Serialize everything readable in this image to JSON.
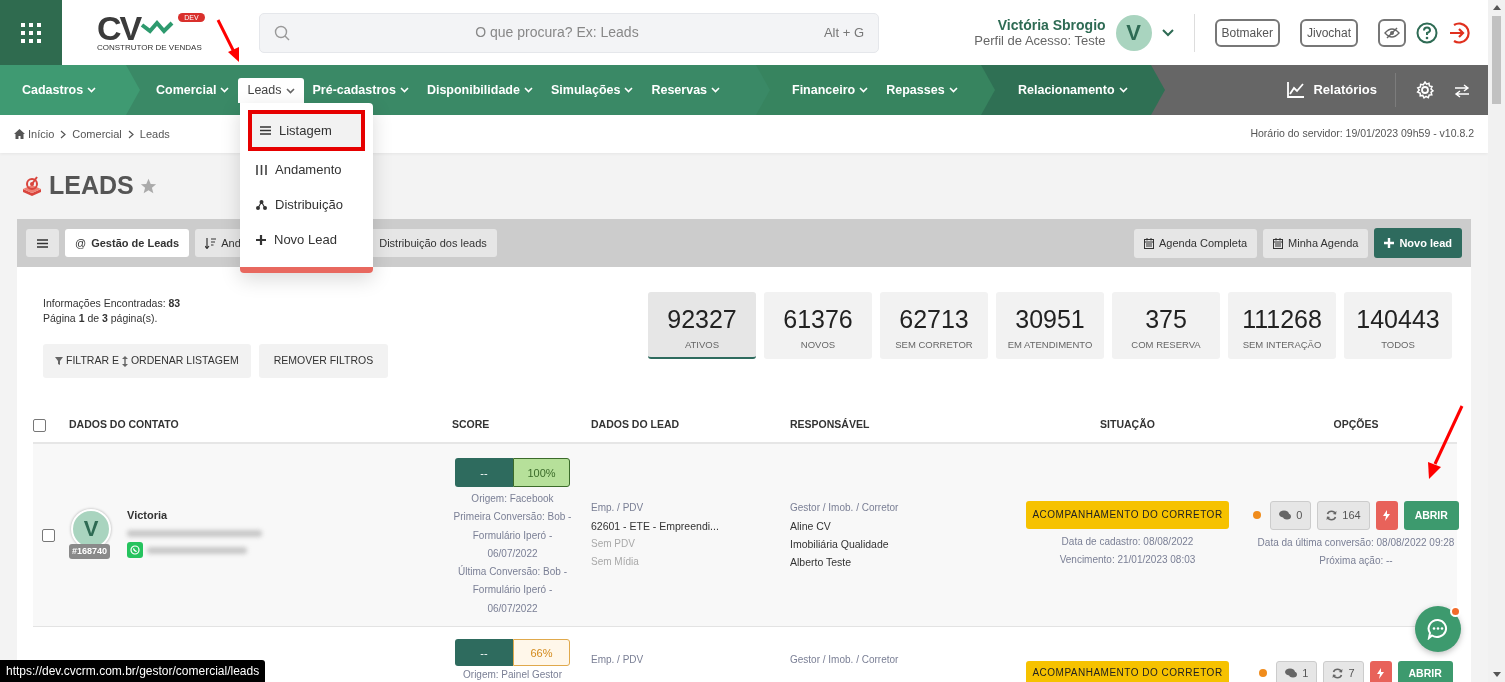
{
  "header": {
    "logo": {
      "text": "CV",
      "badge": "DEV",
      "tagline": "CONSTRUTOR DE VENDAS"
    },
    "search": {
      "placeholder": "O que procura? Ex: Leads",
      "shortcut": "Alt + G"
    },
    "user": {
      "name": "Victória Sbrogio",
      "profile": "Perfil de Acesso: Teste",
      "initial": "V"
    },
    "buttons": [
      "Botmaker",
      "Jivochat"
    ]
  },
  "nav": {
    "groups": [
      {
        "color": "#3f9a72",
        "items": [
          {
            "label": "Cadastros",
            "selected": false
          }
        ]
      },
      {
        "color": "#3a8966",
        "items": [
          {
            "label": "Comercial",
            "selected": false
          },
          {
            "label": "Leads",
            "selected": true
          },
          {
            "label": "Pré-cadastros",
            "selected": false
          },
          {
            "label": "Disponibilidade",
            "selected": false
          },
          {
            "label": "Simulações",
            "selected": false
          },
          {
            "label": "Reservas",
            "selected": false
          }
        ]
      },
      {
        "color": "#37845f",
        "items": [
          {
            "label": "Financeiro",
            "selected": false
          },
          {
            "label": "Repasses",
            "selected": false
          }
        ]
      },
      {
        "color": "#2f7054",
        "items": [
          {
            "label": "Relacionamento",
            "selected": false
          }
        ]
      }
    ],
    "reports": "Relatórios"
  },
  "menu": {
    "items": [
      {
        "label": "Listagem",
        "kind": "list",
        "selected": true
      },
      {
        "label": "Andamento",
        "kind": "columns",
        "selected": false
      },
      {
        "label": "Distribuição",
        "kind": "network",
        "selected": false
      },
      {
        "label": "Novo Lead",
        "kind": "plus",
        "selected": false
      }
    ]
  },
  "breadcrumb": [
    "Início",
    "Comercial",
    "Leads"
  ],
  "server_time": "Horário do servidor: 19/01/2023 09h59 - v10.8.2",
  "page": {
    "title": "LEADS",
    "favorite": false
  },
  "toolbar": {
    "tabs": [
      {
        "label": "Gestão de Leads",
        "icon_char": "@",
        "selected": true
      },
      {
        "label": "And",
        "selected": false
      },
      {
        "label": "Distribuição dos leads",
        "selected": false
      }
    ],
    "actions": [
      {
        "label": "Agenda Completa",
        "kind": "calendar"
      },
      {
        "label": "Minha Agenda",
        "kind": "calendar"
      },
      {
        "label": "Novo lead",
        "kind": "primary"
      }
    ]
  },
  "info": [
    "Informações Encontradas: **83**",
    "Página **1** de **3** página(s)."
  ],
  "filters": {
    "filter_parts": [
      "FILTRAR E",
      "ORDENAR LISTAGEM"
    ],
    "clear": "REMOVER FILTROS"
  },
  "stats": [
    {
      "value": "92327",
      "label": "ATIVOS",
      "selected": true
    },
    {
      "value": "61376",
      "label": "NOVOS",
      "selected": false
    },
    {
      "value": "62713",
      "label": "SEM CORRETOR",
      "selected": false
    },
    {
      "value": "30951",
      "label": "EM ATENDIMENTO",
      "selected": false
    },
    {
      "value": "375",
      "label": "COM RESERVA",
      "selected": false
    },
    {
      "value": "111268",
      "label": "SEM INTERAÇÃO",
      "selected": false
    },
    {
      "value": "140443",
      "label": "TODOS",
      "selected": false
    }
  ],
  "table": {
    "all_checked": false,
    "columns": [
      "DADOS DO CONTATO",
      "SCORE",
      "DADOS DO LEAD",
      "RESPONSÁVEL",
      "SITUAÇÃO",
      "OPÇÕES"
    ],
    "rows": [
      {
        "checked": false,
        "contact": {
          "initial": "V",
          "name": "Victoria",
          "id": "#168740"
        },
        "score": {
          "value": "--",
          "percent": "100%",
          "kind": "good"
        },
        "origin": [
          "Origem: Facebook",
          "Primeira Conversão: Bob - Formulário Iperó - 06/07/2022",
          "Última Conversão: Bob - Formulário Iperó - 06/07/2022"
        ],
        "lead": {
          "label": "Emp. / PDV",
          "lines": [
            "62601 - ETE - Empreendi..."
          ],
          "faded": [
            "Sem PDV",
            "Sem Mídia"
          ]
        },
        "responsible": {
          "label": "Gestor / Imob. / Corretor",
          "lines": [
            "Aline CV",
            "Imobiliária Qualidade",
            "Alberto Teste"
          ]
        },
        "status": {
          "label": "ACOMPANHAMENTO DO CORRETOR",
          "lines": [
            "Data de cadastro: 08/08/2022",
            "Vencimento: 21/01/2023 08:03"
          ]
        },
        "options": {
          "comments": "0",
          "interactions": "164",
          "open": "ABRIR",
          "lines": [
            "Data da última conversão: 08/08/2022 09:28",
            "Próxima ação: --"
          ]
        }
      },
      {
        "score": {
          "value": "--",
          "percent": "66%",
          "kind": "warn"
        },
        "origin": [
          "Origem: Painel Gestor"
        ],
        "lead": {
          "label": "Emp. / PDV"
        },
        "responsible": {
          "label": "Gestor / Imob. / Corretor"
        },
        "status": {
          "label": "ACOMPANHAMENTO DO CORRETOR"
        },
        "options": {
          "comments": "1",
          "interactions": "7",
          "open": "ABRIR"
        }
      }
    ]
  },
  "status_bar": "https://dev.cvcrm.com.br/gestor/comercial/leads"
}
